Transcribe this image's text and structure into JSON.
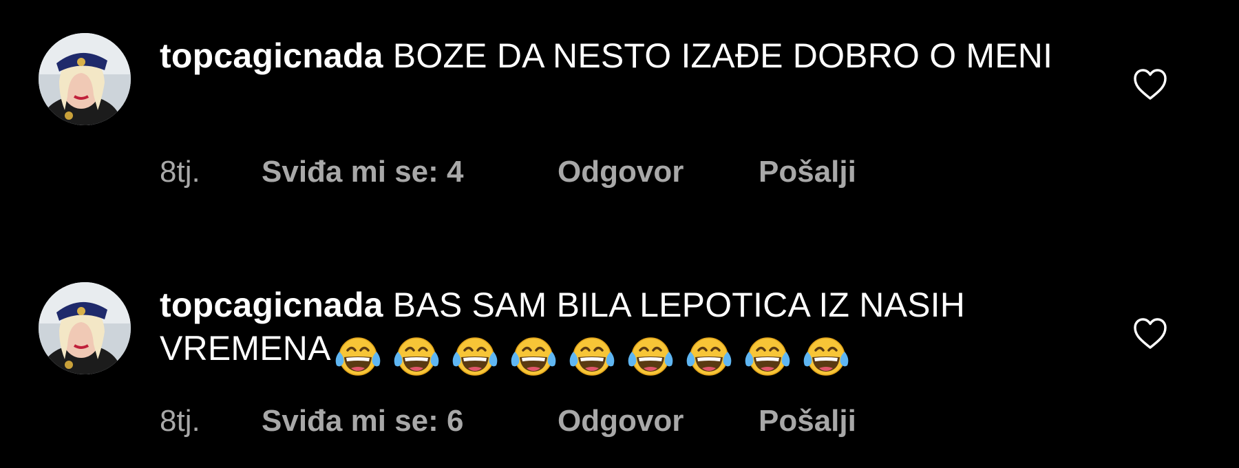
{
  "comments": [
    {
      "username": "topcagicnada",
      "message": "BOZE DA NESTO IZAĐE DOBRO O MENI",
      "emoji_count": 0,
      "time": "8tj.",
      "likes": "Sviđa mi se: 4",
      "reply": "Odgovor",
      "send": "Pošalji"
    },
    {
      "username": "topcagicnada",
      "message": "BAS SAM BILA LEPOTICA IZ NASIH VREMENA",
      "emoji": "face-with-tears-of-joy",
      "emoji_count": 9,
      "time": "8tj.",
      "likes": "Sviđa mi se: 6",
      "reply": "Odgovor",
      "send": "Pošalji"
    }
  ],
  "icons": {
    "like": "heart-outline-icon",
    "emoji": "face-with-tears-of-joy"
  },
  "colors": {
    "background": "#000000",
    "text": "#ffffff",
    "meta_text": "#a8a8a8"
  }
}
